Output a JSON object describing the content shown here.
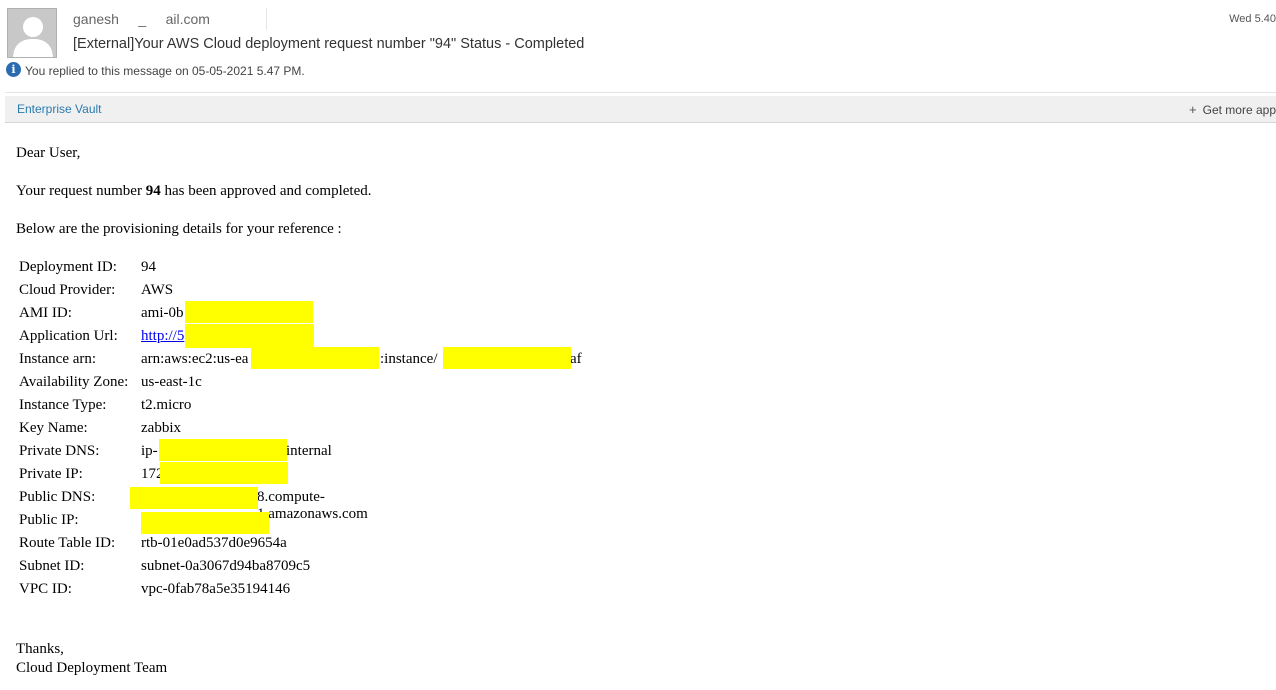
{
  "header": {
    "sender": "ganesh     _     ail.com",
    "subject": "[External]Your AWS Cloud deployment request number \"94\" Status - Completed",
    "date": "Wed 5.40",
    "replied_notice": "You replied to this message on 05-05-2021 5.47 PM."
  },
  "appbar": {
    "enterprise_vault": "Enterprise Vault",
    "get_more_apps": "Get more app"
  },
  "body": {
    "greeting": "Dear User,",
    "request_prefix": "Your request number ",
    "request_number": "94",
    "request_suffix": " has been approved and completed.",
    "details_intro": "Below are the provisioning details for your reference :",
    "details": [
      {
        "label": "Deployment ID:",
        "value": "94"
      },
      {
        "label": "Cloud Provider:",
        "value": "AWS"
      },
      {
        "label": "AMI ID:",
        "value": "ami-0b"
      },
      {
        "label": "Application Url:",
        "value": "http://5"
      },
      {
        "label": "Instance arn:",
        "value": "arn:aws:ec2:us-ea",
        "value_mid": ":instance/",
        "value_end": "af"
      },
      {
        "label": "Availability Zone:",
        "value": "us-east-1c"
      },
      {
        "label": "Instance Type:",
        "value": "t2.micro"
      },
      {
        "label": "Key Name:",
        "value": "zabbix"
      },
      {
        "label": "Private DNS:",
        "value": "ip-",
        "value_end": "internal"
      },
      {
        "label": "Private IP:",
        "value": "172"
      },
      {
        "label": "Public DNS:",
        "value_end": "8.compute-1.amazonaws.com"
      },
      {
        "label": "Public IP:",
        "value": ""
      },
      {
        "label": "Route Table ID:",
        "value": "rtb-01e0ad537d0e9654a"
      },
      {
        "label": "Subnet ID:",
        "value": "subnet-0a3067d94ba8709c5"
      },
      {
        "label": "VPC ID:",
        "value": "vpc-0fab78a5e35194146"
      }
    ],
    "signoff": "Thanks,",
    "team": "Cloud Deployment Team"
  },
  "colors": {
    "redaction": "#ffff00",
    "link": "#0000ee",
    "info_icon": "#2b6cb0",
    "app_link": "#2a7ab0"
  },
  "icons": [
    "avatar-placeholder-icon",
    "info-icon",
    "plus-icon"
  ]
}
